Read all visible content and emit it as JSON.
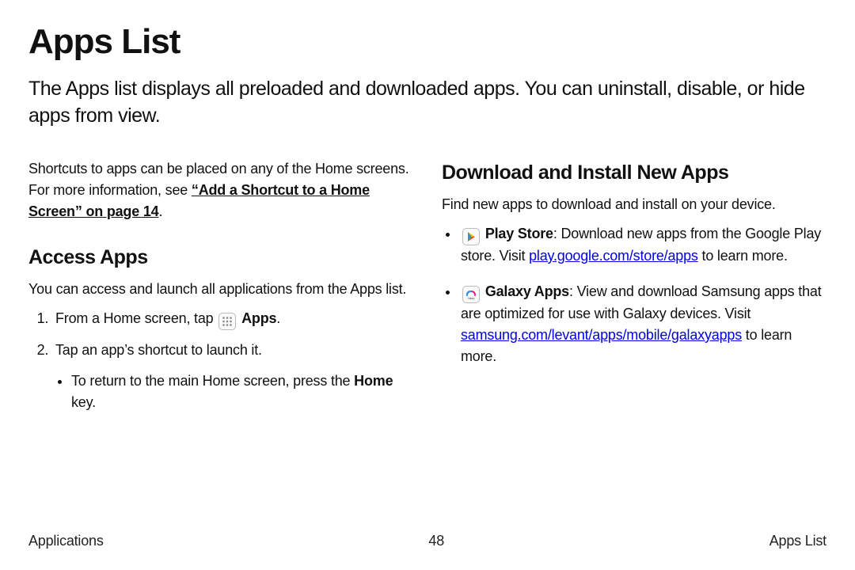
{
  "title": "Apps List",
  "intro": "The Apps list displays all preloaded and downloaded apps. You can uninstall, disable, or hide apps from view.",
  "left": {
    "shortcuts_pre": "Shortcuts to apps can be placed on any of the Home screens. For more information, see ",
    "shortcuts_link": "“Add a Shortcut to a Home Screen” on page 14",
    "shortcuts_post": ".",
    "access_heading": "Access Apps",
    "access_intro": "You can access and launch all applications from the Apps list.",
    "step1_pre": "From a Home screen, tap ",
    "step1_bold": "Apps",
    "step1_post": ".",
    "step2": "Tap an app’s shortcut to launch it.",
    "step2_sub_pre": "To return to the main Home screen, press the ",
    "step2_sub_bold": "Home",
    "step2_sub_post": " key."
  },
  "right": {
    "download_heading": "Download and Install New Apps",
    "download_intro": "Find new apps to download and install on your device.",
    "play_name": "Play Store",
    "play_desc_pre": ": Download new apps from the Google Play store. Visit ",
    "play_link": "play.google.com/store/apps",
    "play_desc_post": " to learn more.",
    "galaxy_name": "Galaxy Apps",
    "galaxy_desc_pre": ": View and download Samsung apps that are optimized for use with Galaxy devices. Visit ",
    "galaxy_link": "samsung.com/levant/apps/mobile/galaxyapps",
    "galaxy_desc_post": " to learn more."
  },
  "footer": {
    "left": "Applications",
    "center": "48",
    "right": "Apps List"
  }
}
